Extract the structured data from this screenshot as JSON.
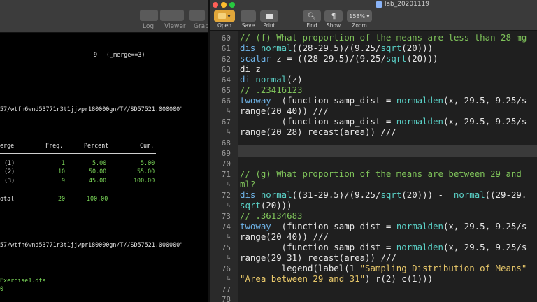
{
  "left_pane": {
    "toolbar": {
      "log_label": "Log",
      "viewer_label": "Viewer",
      "graph_label": "Grap"
    },
    "merge_count": "9",
    "merge_note": "(_merge==3)",
    "path1": "57/wtfn6wnd53771r3t1jjwpr180000gn/T//SD57521.000000\"",
    "table": {
      "header": {
        "col0": "erge",
        "col1": "Freq.",
        "col2": "Percent",
        "col3": "Cum."
      },
      "rows": [
        {
          "label": "(1)",
          "freq": "1",
          "pct": "5.00",
          "cum": "5.00"
        },
        {
          "label": "(2)",
          "freq": "10",
          "pct": "50.00",
          "cum": "55.00"
        },
        {
          "label": "(3)",
          "freq": "9",
          "pct": "45.00",
          "cum": "100.00"
        }
      ],
      "total": {
        "label": "otal",
        "freq": "20",
        "pct": "100.00"
      }
    },
    "path2": "57/wtfn6wnd53771r3t1jjwpr180000gn/T//SD57521.000000\"",
    "file": "Exercise1.dta",
    "zero": "0"
  },
  "editor": {
    "title": "lab_20201119",
    "toolbar": {
      "open_label": "Open",
      "save_label": "Save",
      "print_label": "Print",
      "find_label": "Find",
      "show_label": "Show",
      "zoom_label": "Zoom",
      "zoom_value": "158%"
    },
    "line_numbers": [
      "60",
      "61",
      "62",
      "63",
      "64",
      "65",
      "66",
      "67",
      "68",
      "69",
      "70",
      "71",
      "72",
      "73",
      "74",
      "75",
      "76",
      "77",
      "78"
    ],
    "wrap_mark": "↳",
    "code": {
      "l60": "// (f) What proportion of the means are less than 28 mg",
      "l61a": "dis ",
      "l61b": "normal",
      "l61c": "((28-29.5)/(9.25/",
      "l61d": "sqrt",
      "l61e": "(20)))",
      "l62a": "scalar",
      "l62b": " z = ((28-29.5)/(9.25/",
      "l62c": "sqrt",
      "l62d": "(20)))",
      "l63": "di z",
      "l64a": "di ",
      "l64b": "normal",
      "l64c": "(z)",
      "l65": "// .23416123",
      "l66a": "twoway",
      "l66b": "  (function samp_dist = ",
      "l66c": "normalden",
      "l66d": "(x, 29.5, 9.25/s",
      "l66w": "range(20 40)) ///",
      "l67a": "        (function samp_dist = ",
      "l67b": "normalden",
      "l67c": "(x, 29.5, 9.25/s",
      "l67w": "range(20 28) recast(area)) ///",
      "l71": "// (g) What proportion of the means are between 29 and",
      "l71w": "ml?",
      "l72a": "dis ",
      "l72b": "normal",
      "l72c": "((31-29.5)/(9.25/",
      "l72d": "sqrt",
      "l72e": "(20))) -  ",
      "l72f": "normal",
      "l72g": "((29-29.",
      "l72wa": "sqrt",
      "l72wb": "(20)))",
      "l72x": "// .36134683",
      "l74a": "twoway",
      "l74b": "  (function samp_dist = ",
      "l74c": "normalden",
      "l74d": "(x, 29.5, 9.25/s",
      "l74w": "range(20 40)) ///",
      "l75a": "        (function samp_dist = ",
      "l75b": "normalden",
      "l75c": "(x, 29.5, 9.25/s",
      "l75w": "range(29 31) recast(area)) ///",
      "l76a": "        legend(label(1 ",
      "l76b": "\"Sampling Distribution of Means\"",
      "l76w1": "\"Area between 29 and 31\"",
      "l76w2": ") r(2) c(1)))"
    }
  }
}
